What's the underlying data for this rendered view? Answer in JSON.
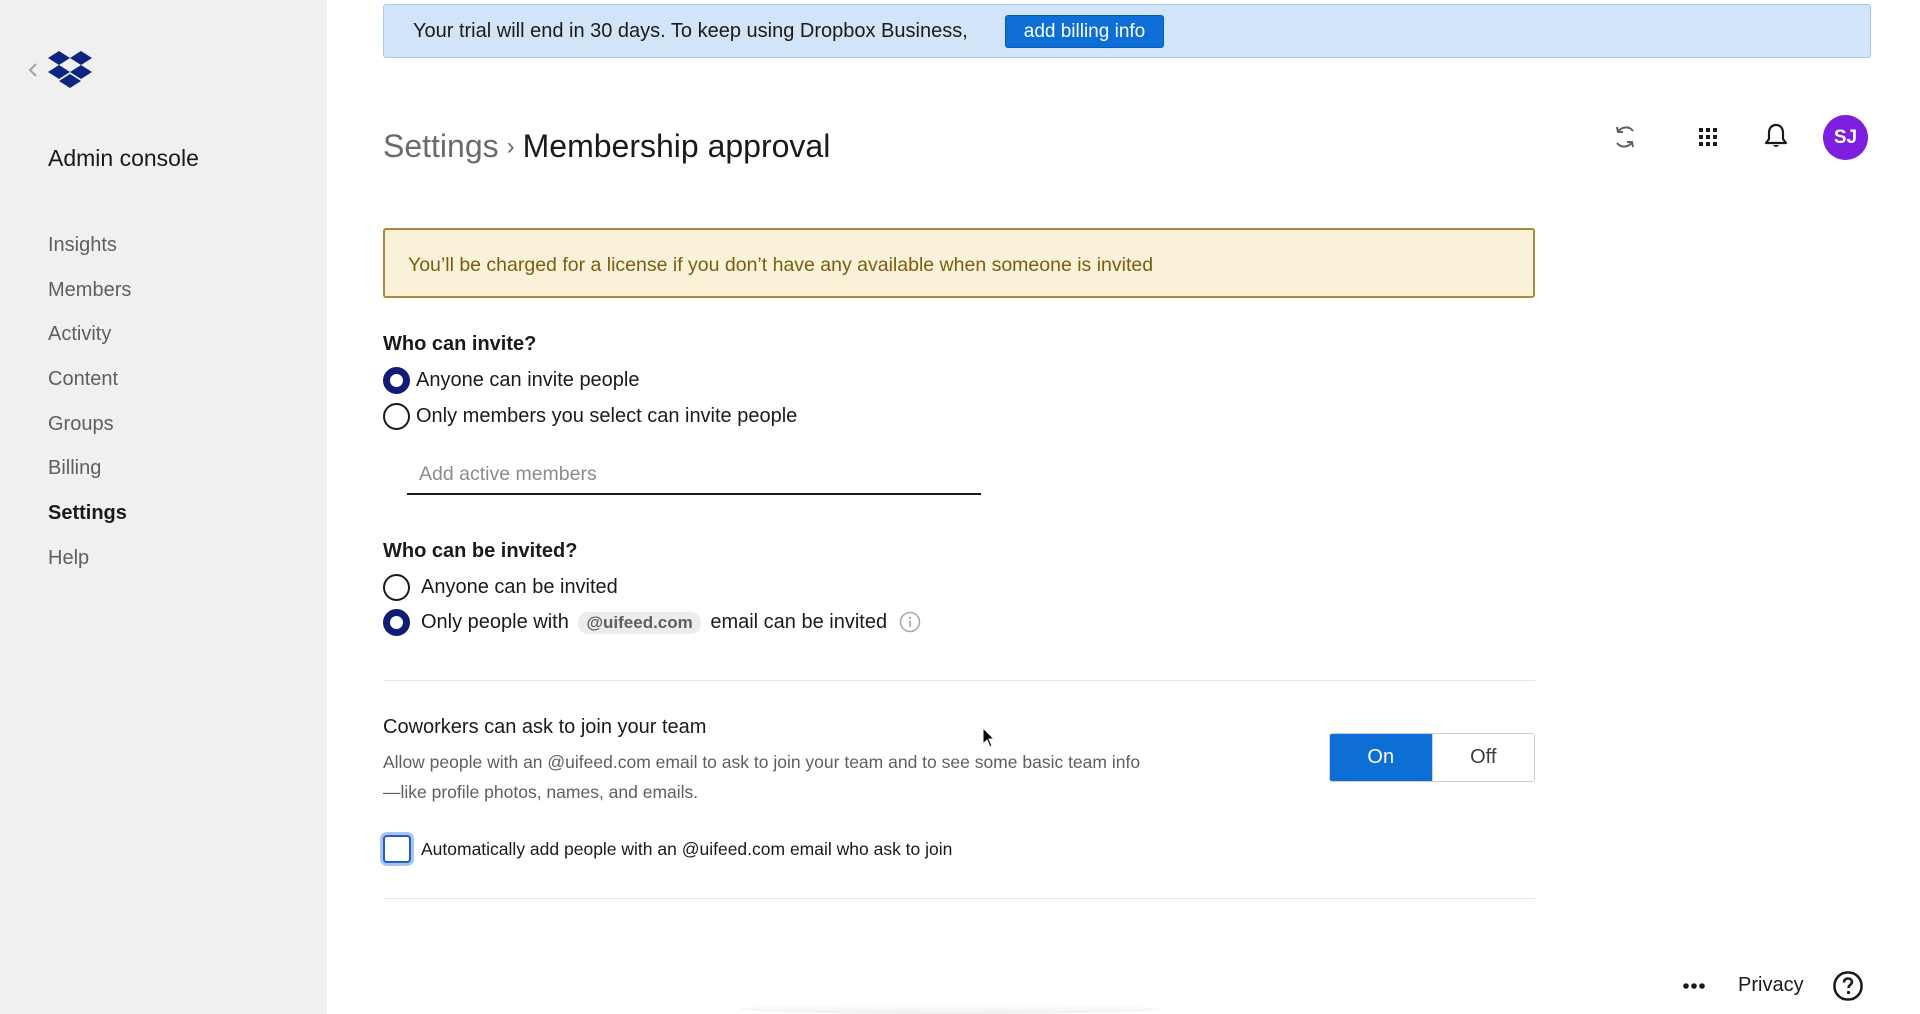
{
  "sidebar": {
    "back_label": "Back",
    "logo": "dropbox-logo",
    "title": "Admin console",
    "items": [
      {
        "label": "Insights",
        "active": false
      },
      {
        "label": "Members",
        "active": false
      },
      {
        "label": "Activity",
        "active": false
      },
      {
        "label": "Content",
        "active": false
      },
      {
        "label": "Groups",
        "active": false
      },
      {
        "label": "Billing",
        "active": false
      },
      {
        "label": "Settings",
        "active": true
      },
      {
        "label": "Help",
        "active": false
      }
    ]
  },
  "banner": {
    "text": "Your trial will end in 30 days. To keep using Dropbox Business,",
    "button_label": "add billing info"
  },
  "header": {
    "breadcrumb_parent": "Settings",
    "breadcrumb_separator": "›",
    "page_title": "Membership approval",
    "icons": [
      "refresh-icon",
      "app-grid-icon",
      "bell-icon"
    ],
    "avatar_initials": "SJ",
    "avatar_color": "#7e1fe0"
  },
  "warning": {
    "text": "You’ll be charged for a license if you don’t have any available when someone is invited"
  },
  "who_can_invite": {
    "heading": "Who can invite?",
    "options": [
      {
        "label": "Anyone can invite people",
        "selected": true
      },
      {
        "label": "Only members you select can invite people",
        "selected": false
      }
    ],
    "members_input": {
      "value": "",
      "placeholder": "Add active members"
    }
  },
  "who_can_be_invited": {
    "heading": "Who can be invited?",
    "options": [
      {
        "label": "Anyone can be invited",
        "selected": false
      },
      {
        "label_prefix": "Only people with",
        "domain": "@uifeed.com",
        "label_suffix": "email can be invited",
        "selected": true
      }
    ]
  },
  "coworkers": {
    "title": "Coworkers can ask to join your team",
    "description": "Allow people with an @uifeed.com email to ask to join your team and to see some basic team info—like profile photos, names, and emails.",
    "toggle": {
      "on_label": "On",
      "off_label": "Off",
      "value": "On"
    },
    "auto_add": {
      "label": "Automatically add people with an @uifeed.com email who ask to join",
      "checked": false
    }
  },
  "footer": {
    "more_label": "•••",
    "privacy_label": "Privacy",
    "help_label": "?"
  },
  "colors": {
    "primary": "#0d6fd6",
    "radio_selected": "#111c73",
    "banner_bg": "#d2e4f7",
    "warning_bg": "#faf1d9",
    "warning_text": "#7a5d12",
    "sidebar_bg": "#f0f0f0"
  }
}
